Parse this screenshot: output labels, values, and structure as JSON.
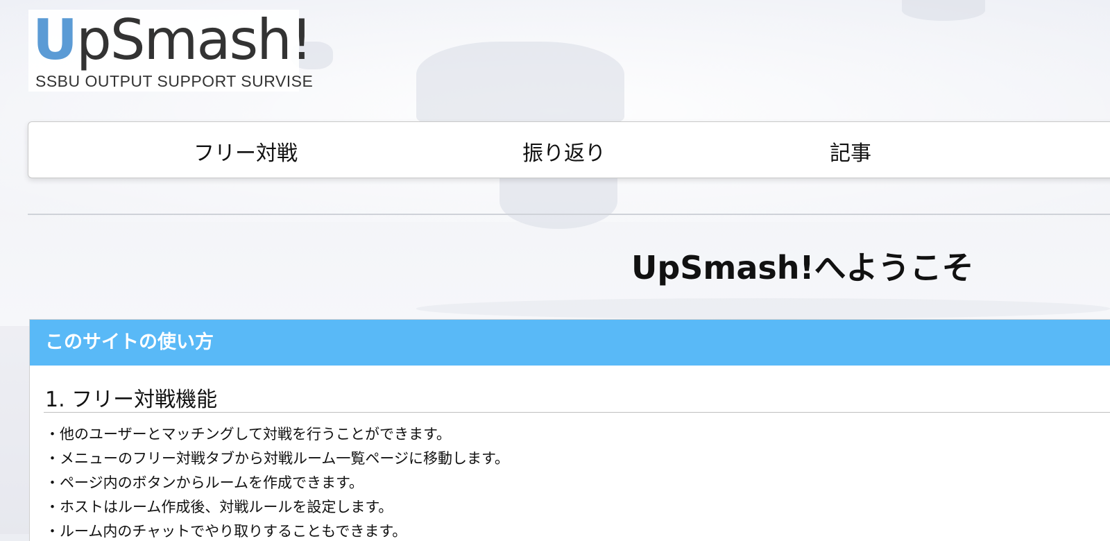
{
  "logo": {
    "letter_u": "U",
    "rest": "pSmash!",
    "tagline": "SSBU OUTPUT SUPPORT SURVISE",
    "accent_color": "#5b9bd5"
  },
  "nav": {
    "items": [
      {
        "label": "フリー対戦"
      },
      {
        "label": "振り返り"
      },
      {
        "label": "記事"
      }
    ]
  },
  "main": {
    "welcome": "UpSmash!へようこそ"
  },
  "card": {
    "header": "このサイトの使い方",
    "header_color": "#59b9f7",
    "section_title": "1. フリー対戦機能",
    "items": [
      "・他のユーザーとマッチングして対戦を行うことができます。",
      "・メニューのフリー対戦タブから対戦ルーム一覧ページに移動します。",
      "・ページ内のボタンからルームを作成できます。",
      "・ホストはルーム作成後、対戦ルールを設定します。",
      "・ルーム内のチャットでやり取りすることもできます。"
    ]
  }
}
